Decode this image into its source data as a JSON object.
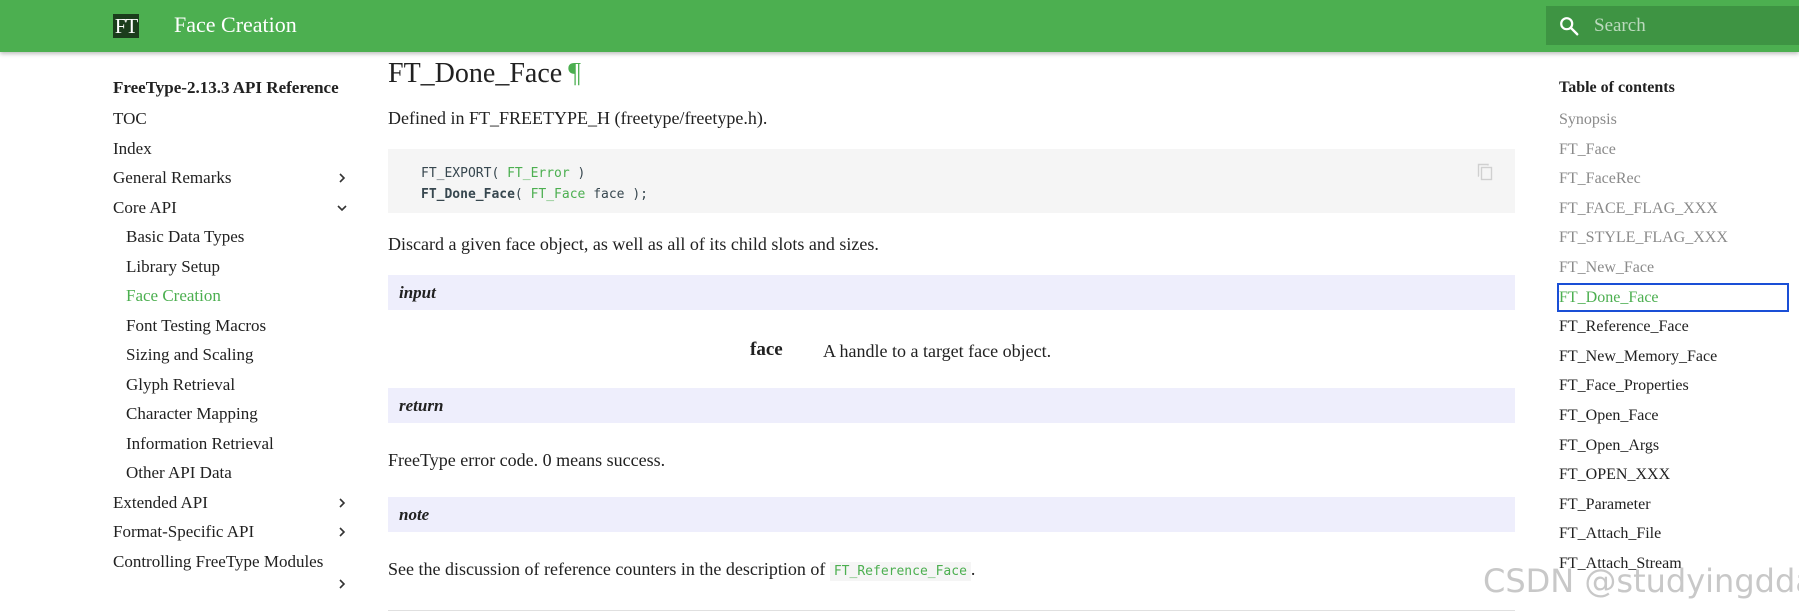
{
  "header": {
    "logo_text": "FT",
    "title": "Face Creation",
    "search_placeholder": "Search",
    "color": "#4caf50"
  },
  "sidebar": {
    "ref_title": "FreeType-2.13.3 API Reference",
    "items": [
      {
        "label": "TOC"
      },
      {
        "label": "Index"
      },
      {
        "label": "General Remarks",
        "icon": "chevron-right-icon"
      },
      {
        "label": "Core API",
        "icon": "chevron-down-icon"
      },
      {
        "label": "Basic Data Types"
      },
      {
        "label": "Library Setup"
      },
      {
        "label": "Face Creation",
        "active": true
      },
      {
        "label": "Font Testing Macros"
      },
      {
        "label": "Sizing and Scaling"
      },
      {
        "label": "Glyph Retrieval"
      },
      {
        "label": "Character Mapping"
      },
      {
        "label": "Information Retrieval"
      },
      {
        "label": "Other API Data"
      },
      {
        "label": "Extended API",
        "icon": "chevron-right-icon"
      },
      {
        "label": "Format-Specific API",
        "icon": "chevron-right-icon"
      },
      {
        "label": "Controlling FreeType Modules",
        "icon": "chevron-right-icon"
      }
    ]
  },
  "main": {
    "heading": "FT_Done_Face",
    "pilcrow": "¶",
    "defined_in": "Defined in FT_FREETYPE_H (freetype/freetype.h).",
    "code": {
      "line1_prefix": "FT_EXPORT( ",
      "line1_type": "FT_Error",
      "line1_suffix": " )",
      "line2_func": "FT_Done_Face",
      "line2_open": "( ",
      "line2_type": "FT_Face",
      "line2_suffix": "  face );"
    },
    "description": "Discard a given face object, as well as all of its child slots and sizes.",
    "input_label": "input",
    "param_name": "face",
    "param_desc": "A handle to a target face object.",
    "return_label": "return",
    "return_text": "FreeType error code. 0 means success.",
    "note_label": "note",
    "note_prefix": "See the discussion of reference counters in the description of ",
    "note_code": "FT_Reference_Face",
    "note_suffix": "."
  },
  "toc": {
    "title": "Table of contents",
    "items": [
      {
        "label": "Synopsis",
        "state": "seen"
      },
      {
        "label": "FT_Face",
        "state": "seen"
      },
      {
        "label": "FT_FaceRec",
        "state": "seen"
      },
      {
        "label": "FT_FACE_FLAG_XXX",
        "state": "seen"
      },
      {
        "label": "FT_STYLE_FLAG_XXX",
        "state": "seen"
      },
      {
        "label": "FT_New_Face",
        "state": "seen"
      },
      {
        "label": "FT_Done_Face",
        "state": "active"
      },
      {
        "label": "FT_Reference_Face",
        "state": "normal"
      },
      {
        "label": "FT_New_Memory_Face",
        "state": "normal"
      },
      {
        "label": "FT_Face_Properties",
        "state": "normal"
      },
      {
        "label": "FT_Open_Face",
        "state": "normal"
      },
      {
        "label": "FT_Open_Args",
        "state": "normal"
      },
      {
        "label": "FT_OPEN_XXX",
        "state": "normal"
      },
      {
        "label": "FT_Parameter",
        "state": "normal"
      },
      {
        "label": "FT_Attach_File",
        "state": "normal"
      },
      {
        "label": "FT_Attach_Stream",
        "state": "normal"
      }
    ]
  },
  "watermark": "CSDN @studyingdda"
}
